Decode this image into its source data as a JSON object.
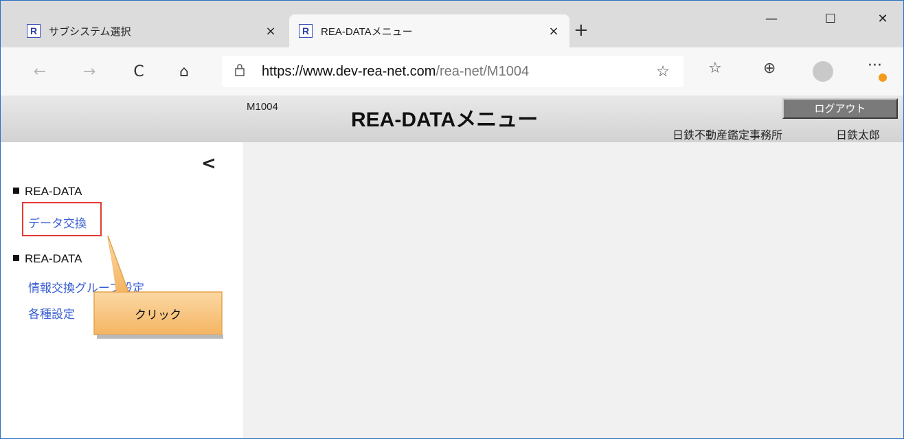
{
  "browser": {
    "tabs": [
      {
        "title": "サブシステム選択",
        "favicon": "R",
        "active": false
      },
      {
        "title": "REA-DATAメニュー",
        "favicon": "R",
        "active": true
      }
    ],
    "close_glyph": "×",
    "new_tab_glyph": "+",
    "window_controls": {
      "minimize": "—",
      "maximize": "☐",
      "close": "✕"
    },
    "nav": {
      "back": "←",
      "forward": "→",
      "refresh": "C",
      "home": "⌂"
    },
    "url": {
      "host": "https://www.dev-rea-net.com",
      "path": "/rea-net/M1004"
    },
    "icons": [
      "lock-icon",
      "add-favorite-icon",
      "favorites-icon",
      "collections-icon",
      "profile-icon",
      "more-icon"
    ],
    "more_glyph": "···"
  },
  "header": {
    "screen_id": "M1004",
    "title": "REA-DATAメニュー",
    "logout_label": "ログアウト",
    "organization": "日鉄不動産鑑定事務所",
    "user_name": "日鉄太郎"
  },
  "sidebar": {
    "collapse_glyph": "<",
    "sections": [
      {
        "heading": "REA-DATA",
        "items": [
          {
            "label": "データ交換"
          }
        ]
      },
      {
        "heading": "REA-DATA",
        "items": [
          {
            "label": "情報交換グループ設定"
          },
          {
            "label": "各種設定"
          }
        ]
      }
    ]
  },
  "annotation": {
    "callout_text": "クリック",
    "callout_fill": "#f7c37a",
    "highlight_color": "#e53935"
  }
}
